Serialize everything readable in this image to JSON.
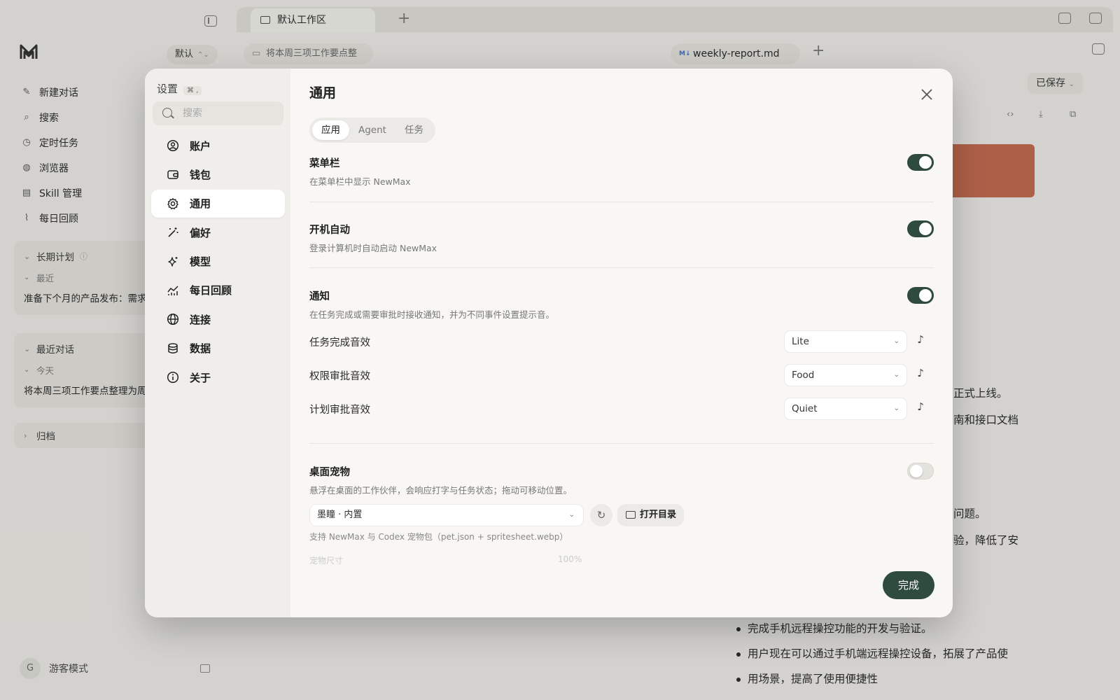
{
  "sidebar": {
    "workspace_select": "默认",
    "nav": [
      {
        "label": "新建对话",
        "icon": "edit-icon"
      },
      {
        "label": "搜索",
        "icon": "search-icon"
      },
      {
        "label": "定时任务",
        "icon": "clock-icon"
      },
      {
        "label": "浏览器",
        "icon": "globe-icon"
      },
      {
        "label": "Skill 管理",
        "icon": "skill-icon"
      },
      {
        "label": "每日回顾",
        "icon": "chart-icon"
      }
    ],
    "long_plan": {
      "title": "长期计划",
      "sub": "最近",
      "item": "准备下个月的产品发布：需求"
    },
    "recent_chats": {
      "title": "最近对话",
      "sub": "今天",
      "item": "将本周三项工作要点整理为周报"
    },
    "archive": "归档",
    "user": {
      "avatar": "G",
      "name": "游客模式"
    }
  },
  "main": {
    "workspace_tab": "默认工作区",
    "chat_pill": "将本周三项工作要点整",
    "file_tab": "weekly-report.md",
    "file_badge": "M↓",
    "saved": "已保存",
    "doc_lines": [
      "正式上线。",
      "南和接口文档",
      "问题。",
      "验，降低了安"
    ],
    "bullets": [
      "完成手机远程操控功能的开发与验证。",
      "用户现在可以通过手机端远程操控设备，拓展了产品使",
      "用场景，提高了使用便捷性"
    ]
  },
  "settings": {
    "title": "设置",
    "shortcut": "⌘ ,",
    "search_placeholder": "搜索",
    "nav": [
      {
        "label": "账户",
        "icon": "account-icon"
      },
      {
        "label": "钱包",
        "icon": "wallet-icon"
      },
      {
        "label": "通用",
        "icon": "gear-icon",
        "active": true
      },
      {
        "label": "偏好",
        "icon": "magic-wand-icon"
      },
      {
        "label": "模型",
        "icon": "sparkle-icon"
      },
      {
        "label": "每日回顾",
        "icon": "chart-icon"
      },
      {
        "label": "连接",
        "icon": "globe-icon"
      },
      {
        "label": "数据",
        "icon": "database-icon"
      },
      {
        "label": "关于",
        "icon": "info-icon"
      }
    ],
    "panel": {
      "heading": "通用",
      "tabs": [
        "应用",
        "Agent",
        "任务"
      ],
      "menubar": {
        "title": "菜单栏",
        "desc": "在菜单栏中显示 NewMax",
        "enabled": true
      },
      "autostart": {
        "title": "开机自动",
        "desc": "登录计算机时自动启动 NewMax",
        "enabled": true
      },
      "notify": {
        "title": "通知",
        "desc": "在任务完成或需要审批时接收通知，并为不同事件设置提示音。",
        "enabled": true
      },
      "sounds": [
        {
          "label": "任务完成音效",
          "value": "Lite"
        },
        {
          "label": "权限审批音效",
          "value": "Food"
        },
        {
          "label": "计划审批音效",
          "value": "Quiet"
        }
      ],
      "pet": {
        "title": "桌面宠物",
        "desc": "悬浮在桌面的工作伙伴，会响应打字与任务状态；拖动可移动位置。",
        "enabled": false,
        "select": "墨瞳 · 内置",
        "open_dir": "打开目录",
        "help": "支持 NewMax 与 Codex 宠物包（pet.json + spritesheet.webp）",
        "faded_label": "宠物尺寸",
        "faded_value": "100%"
      },
      "done": "完成"
    }
  }
}
